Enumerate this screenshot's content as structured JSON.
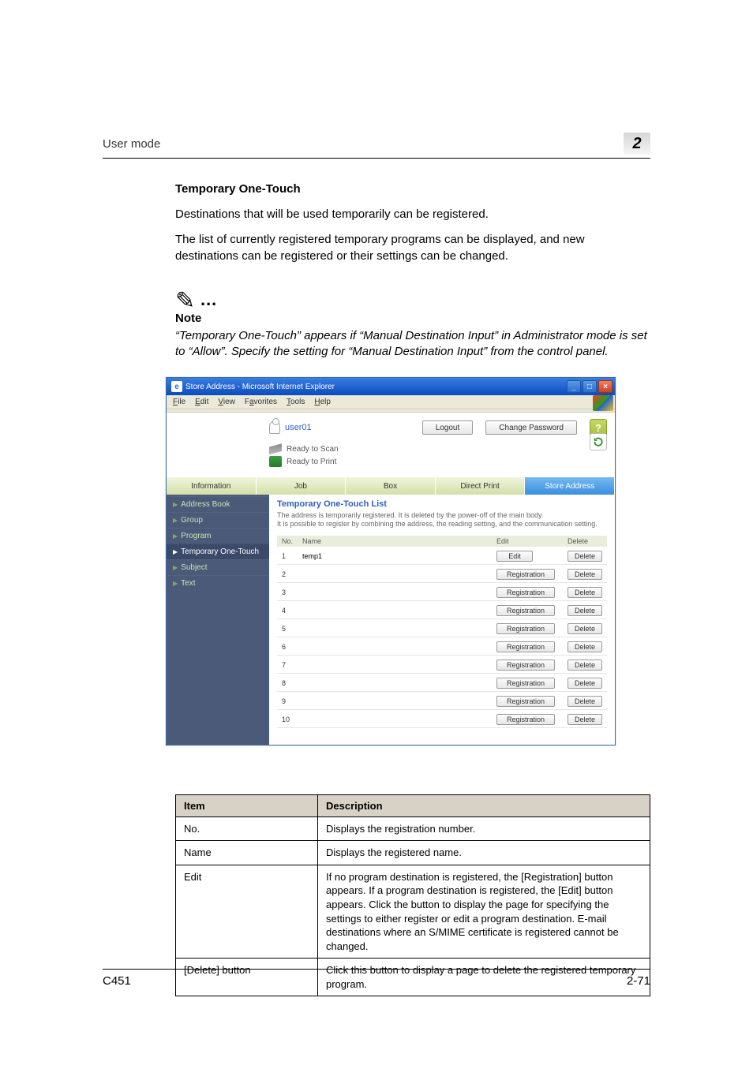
{
  "header": {
    "left": "User mode",
    "badge": "2"
  },
  "section": {
    "title": "Temporary One-Touch",
    "para1": "Destinations that will be used temporarily can be registered.",
    "para2": "The list of currently registered temporary programs can be displayed, and new destinations can be registered or their settings can be changed."
  },
  "note": {
    "label": "Note",
    "text": "“Temporary One-Touch” appears if “Manual Destination Input” in Administrator mode is set to “Allow”. Specify the setting for “Manual Destination Input” from the control panel."
  },
  "scr": {
    "title": "Store Address - Microsoft Internet Explorer",
    "menus": {
      "file": "File",
      "edit": "Edit",
      "view": "View",
      "favorites": "Favorites",
      "tools": "Tools",
      "help": "Help"
    },
    "user": "user01",
    "buttons": {
      "logout": "Logout",
      "change_password": "Change Password"
    },
    "ready1": "Ready to Scan",
    "ready2": "Ready to Print",
    "tabs": {
      "information": "Information",
      "job": "Job",
      "box": "Box",
      "direct_print": "Direct Print",
      "store_address": "Store Address"
    },
    "sidebar": {
      "address_book": "Address Book",
      "group": "Group",
      "program": "Program",
      "temp_one_touch": "Temporary One-Touch",
      "subject": "Subject",
      "text": "Text"
    },
    "pane_title": "Temporary One-Touch List",
    "pane_desc1": "The address is temporarily registered. It is deleted by the power-off of the main body.",
    "pane_desc2": "It is possible to register by combining the address, the reading setting, and the communication setting.",
    "th": {
      "no": "No.",
      "name": "Name",
      "edit": "Edit",
      "delete": "Delete"
    },
    "rows": [
      {
        "no": "1",
        "name": "temp1",
        "edit": "Edit",
        "del": "Delete"
      },
      {
        "no": "2",
        "name": "",
        "edit": "Registration",
        "del": "Delete"
      },
      {
        "no": "3",
        "name": "",
        "edit": "Registration",
        "del": "Delete"
      },
      {
        "no": "4",
        "name": "",
        "edit": "Registration",
        "del": "Delete"
      },
      {
        "no": "5",
        "name": "",
        "edit": "Registration",
        "del": "Delete"
      },
      {
        "no": "6",
        "name": "",
        "edit": "Registration",
        "del": "Delete"
      },
      {
        "no": "7",
        "name": "",
        "edit": "Registration",
        "del": "Delete"
      },
      {
        "no": "8",
        "name": "",
        "edit": "Registration",
        "del": "Delete"
      },
      {
        "no": "9",
        "name": "",
        "edit": "Registration",
        "del": "Delete"
      },
      {
        "no": "10",
        "name": "",
        "edit": "Registration",
        "del": "Delete"
      }
    ]
  },
  "desc_table": {
    "th_item": "Item",
    "th_desc": "Description",
    "rows": [
      {
        "item": "No.",
        "desc": "Displays the registration number."
      },
      {
        "item": "Name",
        "desc": "Displays the registered name."
      },
      {
        "item": "Edit",
        "desc": "If no program destination is registered, the [Registration] button appears. If a program destination is registered, the [Edit] button appears. Click the button to display the page for specifying the settings to either register or edit a program destination. E-mail destinations where an S/MIME certificate is registered cannot be changed."
      },
      {
        "item": "[Delete] button",
        "desc": "Click this button to display a page to delete the registered temporary program."
      }
    ]
  },
  "footer": {
    "left": "C451",
    "right": "2-71"
  }
}
